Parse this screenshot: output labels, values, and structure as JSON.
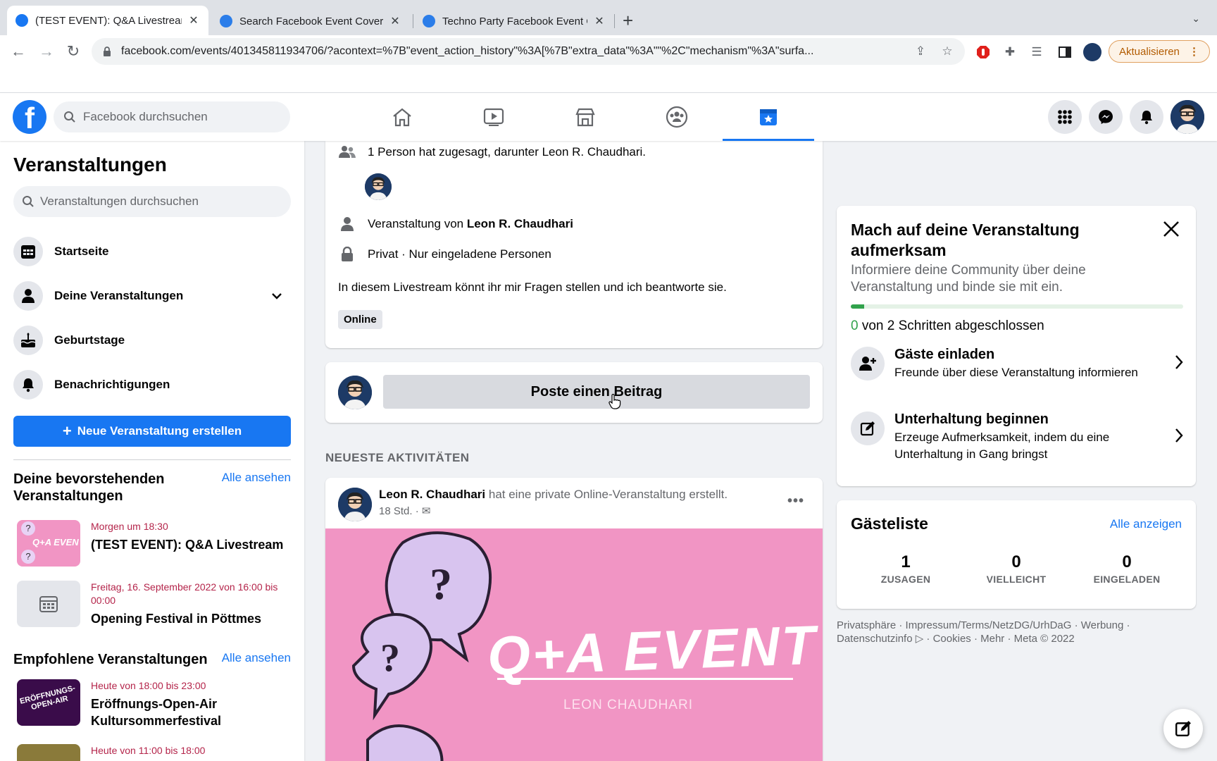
{
  "browser": {
    "tabs": [
      {
        "title": "(TEST EVENT): Q&A Livestream",
        "favicon_color": "#1877f2"
      },
      {
        "title": "Search Facebook Event Cover",
        "favicon_color": "#2b7de9"
      },
      {
        "title": "Techno Party Facebook Event Cover",
        "favicon_color": "#2b7de9"
      }
    ],
    "url": "facebook.com/events/401345811934706/?acontext=%7B\"event_action_history\"%3A[%7B\"extra_data\"%3A\"\"%2C\"mechanism\"%3A\"surfa...",
    "update_button": "Aktualisieren"
  },
  "header": {
    "logo": "f",
    "search_placeholder": "Facebook durchsuchen",
    "nav_icons": [
      "home-icon",
      "watch-icon",
      "marketplace-icon",
      "groups-icon",
      "events-icon"
    ],
    "active_nav": "events-icon",
    "accent": "#1877f2"
  },
  "sidebar": {
    "title": "Veranstaltungen",
    "search_placeholder": "Veranstaltungen durchsuchen",
    "items": [
      {
        "label": "Startseite",
        "icon": "calendar-icon"
      },
      {
        "label": "Deine Veranstaltungen",
        "icon": "person-icon"
      },
      {
        "label": "Geburtstage",
        "icon": "cake-icon"
      },
      {
        "label": "Benachrichtigungen",
        "icon": "bell-icon"
      }
    ],
    "create_button": "Neue Veranstaltung erstellen",
    "upcoming": {
      "heading": "Deine bevorstehenden Veranstaltungen",
      "see_all": "Alle ansehen",
      "events": [
        {
          "when": "Morgen um 18:30",
          "name": "(TEST EVENT): Q&A Livestream"
        },
        {
          "when": "Freitag, 16. September 2022 von 16:00 bis 00:00",
          "name": "Opening Festival in Pöttmes"
        }
      ]
    },
    "recommended": {
      "heading": "Empfohlene Veranstaltungen",
      "see_all": "Alle ansehen",
      "events": [
        {
          "when": "Heute von 18:00 bis 23:00",
          "name": "Eröffnungs-Open-Air Kultursommerfestival",
          "thumb_text": "ERÖFFNUNGS-OPEN-AIR"
        },
        {
          "when": "Heute von 11:00 bis 18:00",
          "name": ""
        }
      ]
    }
  },
  "details": {
    "attending": "1 Person hat zugesagt, darunter Leon R. Chaudhari.",
    "host_prefix": "Veranstaltung von",
    "host_name": "Leon R. Chaudhari",
    "privacy": "Privat · Nur eingeladene Personen",
    "description": "In diesem Livestream könnt ihr mir Fragen stellen und ich beantworte sie.",
    "tag": "Online"
  },
  "composer": {
    "button": "Poste einen Beitrag"
  },
  "activity": {
    "heading": "NEUESTE AKTIVITÄTEN",
    "post": {
      "author": "Leon R. Chaudhari",
      "action": "hat eine private Online-Veranstaltung erstellt.",
      "time": "18 Std. ·",
      "cover_title": "Q+A EVENT",
      "cover_subtitle": "LEON CHAUDHARI"
    }
  },
  "promote": {
    "title": "Mach auf deine Veranstaltung aufmerksam",
    "subtitle": "Informiere deine Community über deine Veranstaltung und binde sie mit ein.",
    "progress_fraction": 0.04,
    "steps_done": "0",
    "steps_text": "von 2 Schritten abgeschlossen",
    "tasks": [
      {
        "title": "Gäste einladen",
        "desc": "Freunde über diese Veranstaltung informieren",
        "icon": "add-person-icon"
      },
      {
        "title": "Unterhaltung beginnen",
        "desc": "Erzeuge Aufmerksamkeit, indem du eine Unterhaltung in Gang bringst",
        "icon": "compose-icon"
      }
    ]
  },
  "guests": {
    "title": "Gästeliste",
    "see_all": "Alle anzeigen",
    "stats": [
      {
        "count": "1",
        "label": "ZUSAGEN"
      },
      {
        "count": "0",
        "label": "VIELLEICHT"
      },
      {
        "count": "0",
        "label": "EINGELADEN"
      }
    ]
  },
  "footer": {
    "line1": "Privatsphäre · Impressum/Terms/NetzDG/UrhDaG · Werbung ·",
    "line2": "Datenschutzinfo ▷ · Cookies · Mehr · Meta © 2022"
  }
}
